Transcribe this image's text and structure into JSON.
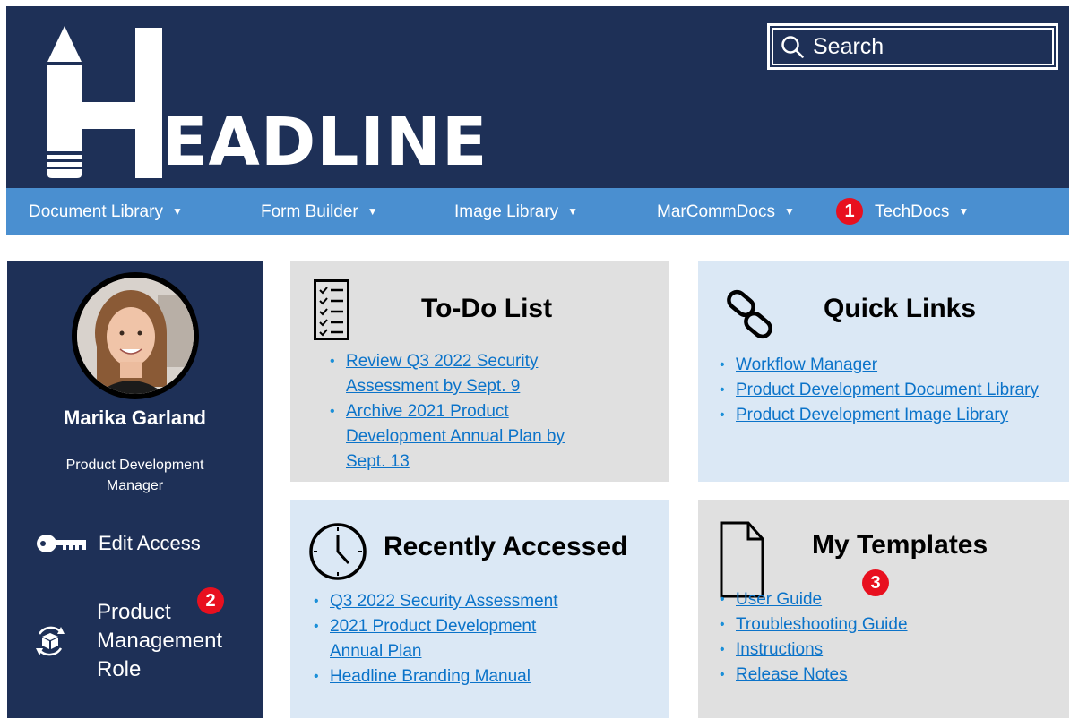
{
  "header": {
    "logo_text": "EADLINE",
    "logo_letter": "H",
    "search_label": "Search"
  },
  "nav": {
    "items": [
      {
        "label": "Document Library"
      },
      {
        "label": "Form Builder"
      },
      {
        "label": "Image Library"
      },
      {
        "label": "MarCommDocs"
      },
      {
        "label": "TechDocs"
      }
    ]
  },
  "callouts": [
    "1",
    "2",
    "3"
  ],
  "profile": {
    "name": "Marika Garland",
    "role": "Product Development Manager",
    "edit_access": "Edit Access",
    "role_link": "Product Management Role"
  },
  "todo": {
    "title": "To-Do List",
    "items": [
      "Review Q3 2022 Security Assessment by Sept. 9",
      "Archive 2021 Product Development Annual Plan by Sept. 13"
    ]
  },
  "quick_links": {
    "title": "Quick Links",
    "items": [
      "Workflow Manager",
      "Product Development Document Library",
      "Product Development Image Library"
    ]
  },
  "recent": {
    "title": "Recently Accessed",
    "items": [
      "Q3 2022 Security Assessment",
      "2021 Product Development Annual Plan",
      "Headline Branding Manual"
    ]
  },
  "templates": {
    "title": "My Templates",
    "items": [
      "User Guide",
      "Troubleshooting Guide",
      "Instructions",
      "Release Notes"
    ]
  },
  "colors": {
    "header_bg": "#1e3057",
    "nav_bg": "#4a8fd0",
    "card_gray": "#e0e0e0",
    "card_blue": "#dbe8f5",
    "link": "#0b73c9",
    "badge": "#e8101f"
  },
  "icons": [
    "pencil-logo-icon",
    "search-icon",
    "caret-down-icon",
    "key-icon",
    "box-cycle-icon",
    "checklist-icon",
    "chain-link-icon",
    "clock-icon",
    "document-icon"
  ]
}
